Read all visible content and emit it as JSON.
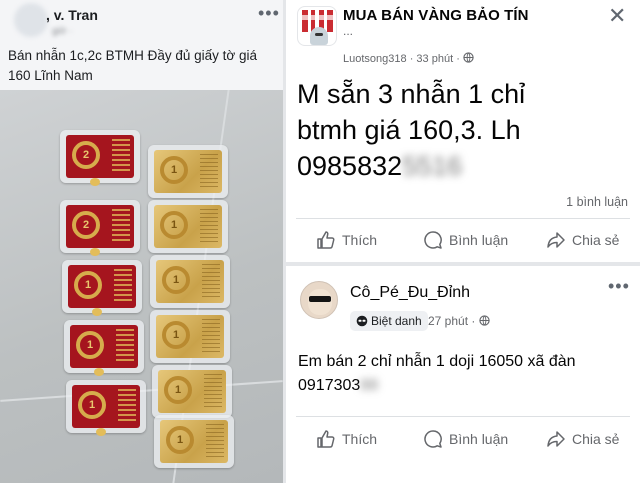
{
  "left_post": {
    "author": ", v. Tran",
    "time": "giờ ·",
    "text": "Bán nhẫn 1c,2c BTMH  Đầy đủ giấy tờ giá 160 Lĩnh Nam",
    "more": "•••",
    "photo_rings": {
      "red": [
        "2",
        "2",
        "1",
        "1",
        "1"
      ],
      "gold": [
        "1",
        "1",
        "1",
        "1",
        "1",
        "1"
      ]
    }
  },
  "post1": {
    "group_name": "MUA BÁN VÀNG BẢO TÍN",
    "group_sub": "...",
    "poster": "Luotsong318",
    "time": "33 phút",
    "text_lines": [
      "M sẵn 3 nhẫn 1 chỉ",
      "btmh giá 160,3. Lh",
      "0985832"
    ],
    "phone_hidden": "5516",
    "comment_count": "1 bình luận",
    "actions": {
      "like": "Thích",
      "comment": "Bình luận",
      "share": "Chia sẻ"
    },
    "close": "✕",
    "more": "•••"
  },
  "post2": {
    "name": "Cô_Pé_Đu_Đỉnh",
    "badge": "Biệt danh",
    "time": "27 phút",
    "text_line1": "Em bán 2 chỉ nhẫn 1 doji 16050 xã đàn",
    "phone_visible": "0917303",
    "phone_hidden": "88",
    "actions": {
      "like": "Thích",
      "comment": "Bình luận",
      "share": "Chia sẻ"
    },
    "more": "•••"
  },
  "colors": {
    "background": "#e4e6e9",
    "card": "#ffffff",
    "secondary_text": "#65676b",
    "red_card": "#a5151e",
    "gold": "#d6ac4c"
  }
}
